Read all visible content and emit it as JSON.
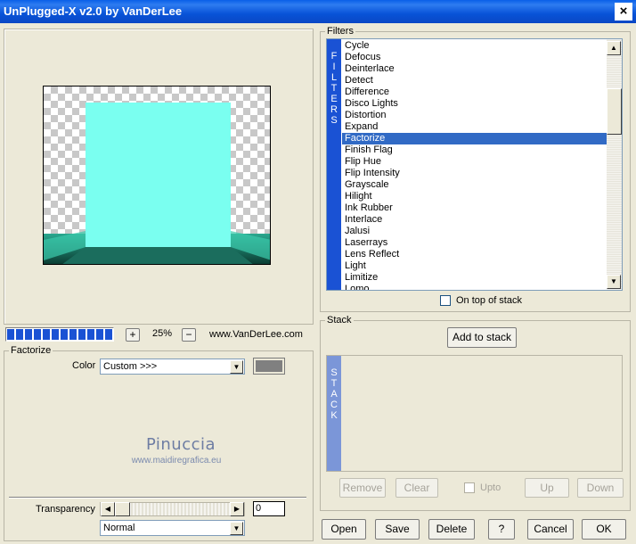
{
  "window": {
    "title": "UnPlugged-X v2.0 by VanDerLee",
    "close_glyph": "×"
  },
  "preview": {
    "zoom_minus": "−",
    "zoom_plus": "+",
    "zoom_value": "25%",
    "website": "www.VanDerLee.com",
    "progress_fraction": 1.0,
    "colors": {
      "aqua": "#7afff0",
      "teal": "#1e8f7a"
    }
  },
  "filters": {
    "group_label": "Filters",
    "vertical_label": [
      "F",
      "I",
      "L",
      "T",
      "E",
      "R",
      "S"
    ],
    "items": [
      "Cycle",
      "Defocus",
      "Deinterlace",
      "Detect",
      "Difference",
      "Disco Lights",
      "Distortion",
      "Expand",
      "Factorize",
      "Finish Flag",
      "Flip Hue",
      "Flip Intensity",
      "Grayscale",
      "Hilight",
      "Ink Rubber",
      "Interlace",
      "Jalusi",
      "Laserrays",
      "Lens Reflect",
      "Light",
      "Limitize",
      "Lomo"
    ],
    "selected": "Factorize",
    "on_top_label": "On top of stack"
  },
  "stack": {
    "group_label": "Stack",
    "add_button": "Add to stack",
    "vertical_label": [
      "S",
      "T",
      "A",
      "C",
      "K"
    ],
    "remove": "Remove",
    "clear": "Clear",
    "upto": "Upto",
    "up": "Up",
    "down": "Down"
  },
  "factorize": {
    "group_label": "Factorize",
    "color_label": "Color",
    "color_value": "Custom >>>",
    "swatch_color": "#808080",
    "watermark_name": "Pinuccia",
    "watermark_url": "www.maidiregrafica.eu",
    "transparency_label": "Transparency",
    "transparency_value": "0",
    "blend_mode": "Normal"
  },
  "footer": {
    "open": "Open",
    "save": "Save",
    "delete": "Delete",
    "help": "?",
    "cancel": "Cancel",
    "ok": "OK"
  }
}
